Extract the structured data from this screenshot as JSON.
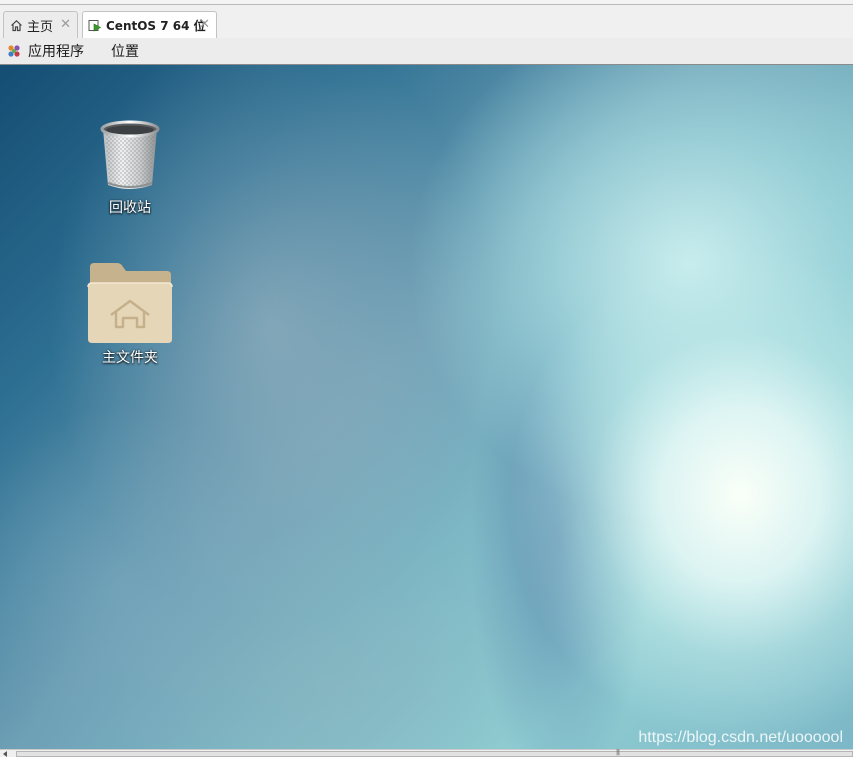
{
  "tabs": [
    {
      "label": "主页",
      "icon": "home-icon",
      "close": "✕"
    },
    {
      "label": "CentOS 7 64 位",
      "icon": "vm-running-icon",
      "close": "✕"
    }
  ],
  "menubar": {
    "applications": "应用程序",
    "places": "位置"
  },
  "desktop": {
    "icons": [
      {
        "label": "回收站",
        "icon": "trash-icon"
      },
      {
        "label": "主文件夹",
        "icon": "home-folder-icon"
      }
    ],
    "watermark": "https://blog.csdn.net/uoooool"
  },
  "scrollbar": {
    "grip": "|||"
  }
}
